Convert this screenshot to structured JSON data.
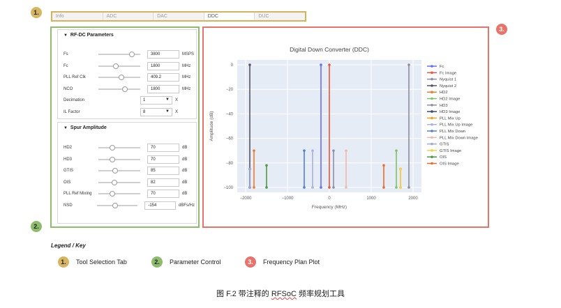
{
  "callouts": {
    "tool_tab": "1.",
    "param": "2.",
    "plot": "3."
  },
  "tabs": [
    {
      "label": "Info",
      "active": false
    },
    {
      "label": "ADC",
      "active": false
    },
    {
      "label": "DAC",
      "active": false
    },
    {
      "label": "DDC",
      "active": true
    },
    {
      "label": "DUC",
      "active": false
    }
  ],
  "rfdc": {
    "title": "RF-DC Parameters",
    "rows": [
      {
        "label": "Fs",
        "value": "3800",
        "unit": "MSPS",
        "slider": 0.85
      },
      {
        "label": "Fc",
        "value": "1800",
        "unit": "MHz",
        "slider": 0.4
      },
      {
        "label": "PLL Ref Clk",
        "value": "409.2",
        "unit": "MHz",
        "slider": 0.55
      },
      {
        "label": "NCO",
        "value": "1800",
        "unit": "MHz",
        "slider": 0.65
      }
    ],
    "selects": [
      {
        "label": "Decimation",
        "value": "1",
        "unit": "X"
      },
      {
        "label": "IL Factor",
        "value": "8",
        "unit": "X"
      }
    ]
  },
  "spur": {
    "title": "Spur Amplitude",
    "rows": [
      {
        "label": "HD2",
        "value": "70",
        "unit": "dB",
        "slider": 0.3
      },
      {
        "label": "HD3",
        "value": "70",
        "unit": "dB",
        "slider": 0.3
      },
      {
        "label": "GTIS",
        "value": "85",
        "unit": "dB",
        "slider": 0.38
      },
      {
        "label": "OIS",
        "value": "82",
        "unit": "dB",
        "slider": 0.36
      },
      {
        "label": "PLL Ref Mixing",
        "value": "70",
        "unit": "dB",
        "slider": 0.3
      },
      {
        "label": "NSD",
        "value": "-154",
        "unit": "dBFs/Hz",
        "slider": 0.42
      }
    ]
  },
  "legend_key": {
    "title": "Legend / Key",
    "items": [
      {
        "num": "1.",
        "label": "Tool Selection Tab"
      },
      {
        "num": "2.",
        "label": "Parameter Control"
      },
      {
        "num": "3.",
        "label": "Frequency Plan Plot"
      }
    ]
  },
  "caption": {
    "prefix": "图 F.2 带注释的 ",
    "rf": "RFSoC",
    "suffix": " 频率规划工具"
  },
  "chart_data": {
    "type": "scatter",
    "title": "Digital Down Converter (DDC)",
    "xlabel": "Frequency (MHz)",
    "ylabel": "Amplitude (dB)",
    "xlim": [
      -2200,
      2200
    ],
    "ylim": [
      -104,
      4
    ],
    "xticks": [
      -2000,
      -1000,
      0,
      1000,
      2000
    ],
    "yticks": [
      0,
      -20,
      -40,
      -60,
      -80,
      -100
    ],
    "grid": true,
    "legend_placement": "right",
    "baseline": -100,
    "series": [
      {
        "name": "Fc",
        "color": "#636efa",
        "points": [
          [
            -200,
            0
          ]
        ]
      },
      {
        "name": "Fc Image",
        "color": "#ef553b",
        "points": [
          [
            0,
            0
          ]
        ]
      },
      {
        "name": "Nyquist 1",
        "color": "#8c8c9c",
        "points": [
          [
            1900,
            0
          ]
        ]
      },
      {
        "name": "Nyquist 2",
        "color": "#555566",
        "points": [
          [
            -1900,
            0
          ]
        ]
      },
      {
        "name": "HD2",
        "color": "#ef7b2a",
        "points": [
          [
            -1800,
            -70
          ]
        ]
      },
      {
        "name": "HD2 Image",
        "color": "#7dc36a",
        "points": [
          [
            1600,
            -70
          ]
        ]
      },
      {
        "name": "HD3",
        "color": "#8d8fa8",
        "points": [
          [
            100,
            -70
          ]
        ]
      },
      {
        "name": "HD3 Image",
        "color": "#3a4a7a",
        "points": [
          [
            -1900,
            -85
          ]
        ]
      },
      {
        "name": "PLL Mix Up",
        "color": "#f0a020",
        "points": [
          [
            1700,
            -85
          ]
        ]
      },
      {
        "name": "PLL Mix Up Image",
        "color": "#a9b2d8",
        "points": [
          [
            -400,
            -70
          ]
        ]
      },
      {
        "name": "PLL Mix Down",
        "color": "#4f7fd6",
        "points": [
          [
            -600,
            -70
          ]
        ]
      },
      {
        "name": "PLL Mix Down Image",
        "color": "#f4b8a8",
        "points": [
          [
            400,
            -70
          ]
        ]
      },
      {
        "name": "GTIS",
        "color": "#9fa8d0",
        "points": [
          [
            -1900,
            -85
          ]
        ]
      },
      {
        "name": "GTIS Image",
        "color": "#f7cf46",
        "points": [
          [
            1700,
            -85
          ]
        ]
      },
      {
        "name": "OIS",
        "color": "#4c9a3c",
        "points": [
          [
            -1500,
            -82
          ]
        ]
      },
      {
        "name": "OIS Image",
        "color": "#ef6a2a",
        "points": [
          [
            1300,
            -82
          ]
        ]
      }
    ]
  }
}
